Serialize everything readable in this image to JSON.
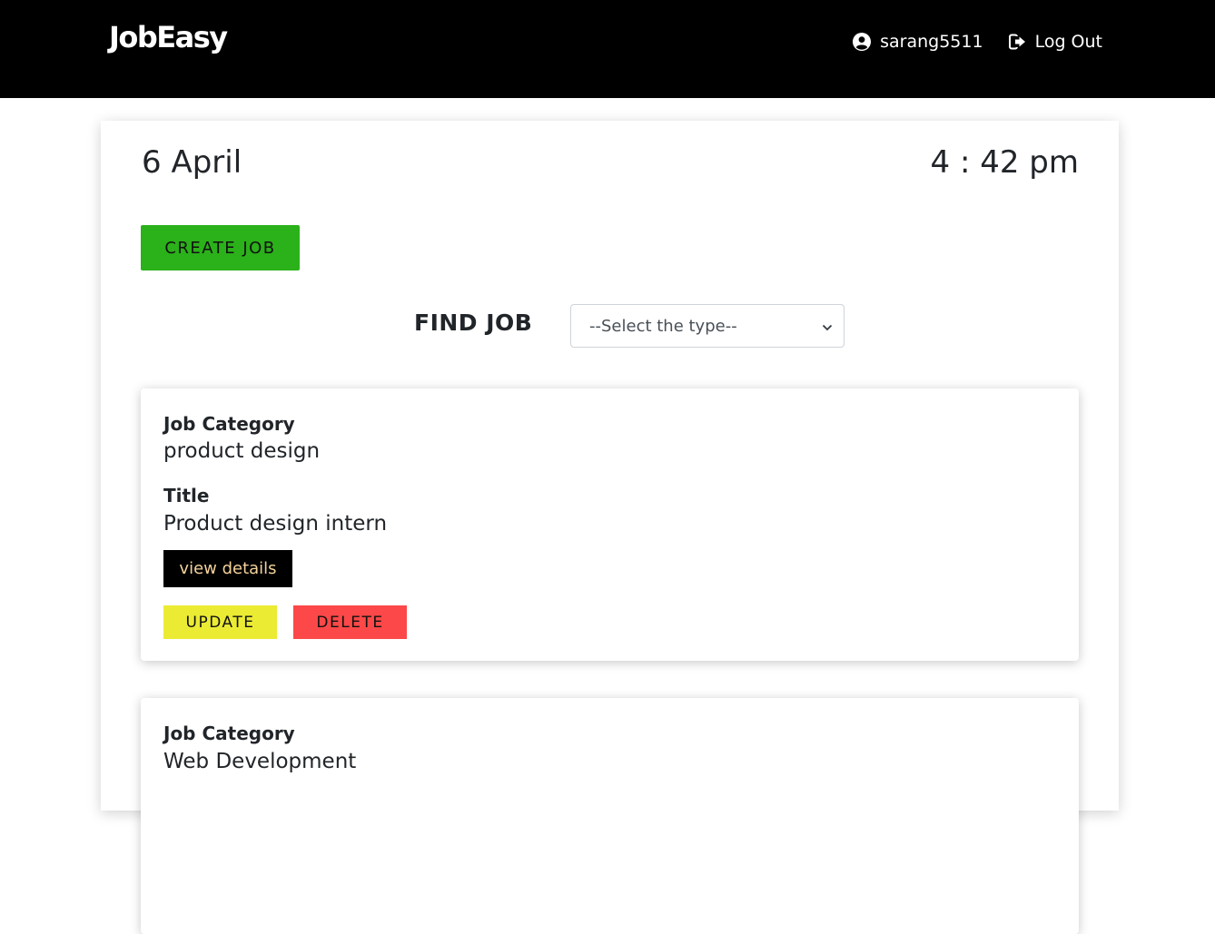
{
  "navbar": {
    "brand": "JobEasy",
    "username": "sarang5511",
    "logout_label": "Log Out"
  },
  "header": {
    "date": "6 April",
    "time": "4 : 42 pm"
  },
  "actions": {
    "create_job_label": "CREATE JOB"
  },
  "filter": {
    "label": "FIND JOB",
    "selected": "--Select the type--"
  },
  "jobs": [
    {
      "category_label": "Job Category",
      "category": "product design",
      "title_label": "Title",
      "title": "Product design intern",
      "view_label": "view details",
      "update_label": "UPDATE",
      "delete_label": "DELETE"
    },
    {
      "category_label": "Job Category",
      "category": "Web Development"
    }
  ],
  "colors": {
    "navbar_bg": "#000000",
    "create_button": "#2bb11a",
    "update_button": "#ebeb34",
    "delete_button": "#fc4848",
    "view_button_text": "#f4d29b"
  },
  "icons": {
    "user": "user-circle-icon",
    "logout": "sign-out-icon",
    "select": "chevron-down-icon"
  }
}
